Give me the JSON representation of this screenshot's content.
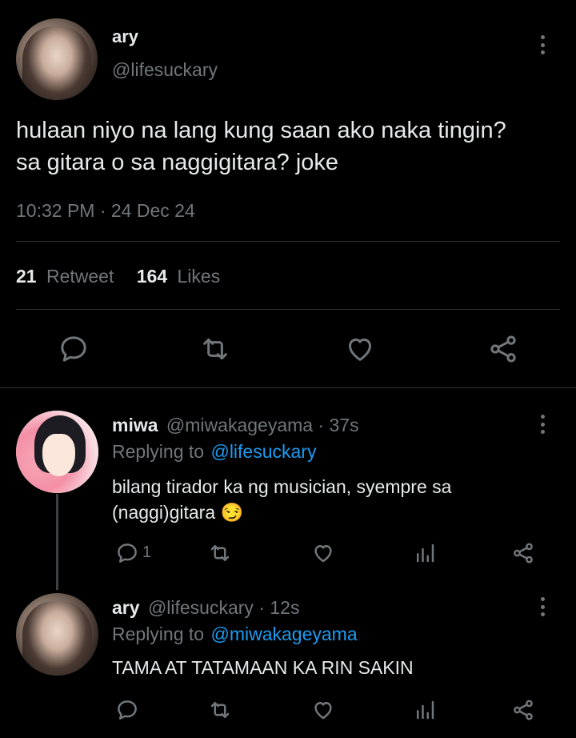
{
  "main_tweet": {
    "display_name": "ary",
    "handle": "@lifesuckary",
    "text_line1": "hulaan niyo na lang kung saan ako naka tingin?",
    "text_line2": "sa gitara o sa naggigitara? joke",
    "timestamp": "10:32 PM · 24 Dec 24",
    "retweet_count": "21",
    "retweet_label": "Retweet",
    "likes_count": "164",
    "likes_label": "Likes"
  },
  "replies": [
    {
      "display_name": "miwa",
      "handle_time": "@miwakageyama · 37s",
      "replying_to_label": "Replying to",
      "replying_to_handle": "@lifesuckary",
      "text_line1": "bilang tirador ka ng musician, syempre sa",
      "text_line2": "(naggi)gitara",
      "emoji": "😏",
      "reply_count": "1"
    },
    {
      "display_name": "ary",
      "handle_time": "@lifesuckary · 12s",
      "replying_to_label": "Replying to",
      "replying_to_handle": "@miwakageyama",
      "text_line1": "TAMA AT TATAMAAN KA RIN SAKIN"
    }
  ],
  "icons": {
    "reply": "reply-icon",
    "retweet": "retweet-icon",
    "like": "heart-icon",
    "share": "share-icon",
    "analytics": "analytics-icon",
    "more": "more-options-icon"
  },
  "colors": {
    "background": "#000000",
    "text": "#e7e9ea",
    "muted": "#71767b",
    "link": "#1d9bf0",
    "divider": "#2f3336"
  }
}
